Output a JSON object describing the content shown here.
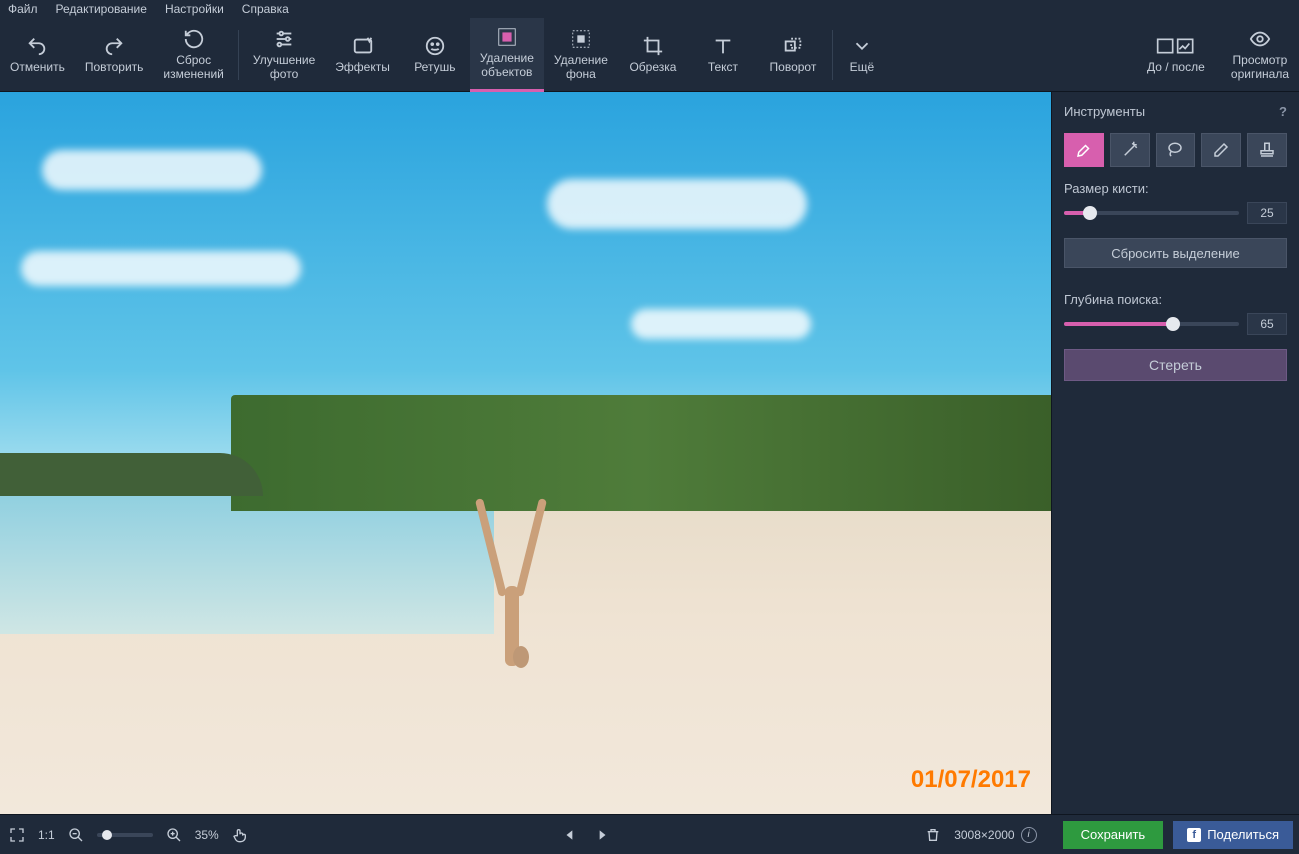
{
  "menu": {
    "file": "Файл",
    "edit": "Редактирование",
    "settings": "Настройки",
    "help": "Справка"
  },
  "toolbar": {
    "undo": "Отменить",
    "redo": "Повторить",
    "reset": "Сброс\nизменений",
    "enhance": "Улучшение\nфото",
    "effects": "Эффекты",
    "retouch": "Ретушь",
    "object_removal": "Удаление\nобъектов",
    "bg_removal": "Удаление\nфона",
    "crop": "Обрезка",
    "text": "Текст",
    "rotate": "Поворот",
    "more": "Ещё",
    "before_after": "До / после",
    "view_original": "Просмотр\nоригинала"
  },
  "panel": {
    "title": "Инструменты",
    "brush_label": "Размер кисти:",
    "brush_value": "25",
    "reset_selection": "Сбросить выделение",
    "depth_label": "Глубина поиска:",
    "depth_value": "65",
    "erase": "Стереть"
  },
  "bottom": {
    "one_to_one": "1:1",
    "zoom_pct": "35%",
    "dimensions": "3008×2000",
    "save": "Сохранить",
    "share": "Поделиться"
  },
  "photo": {
    "date_stamp": "01/07/2017"
  }
}
